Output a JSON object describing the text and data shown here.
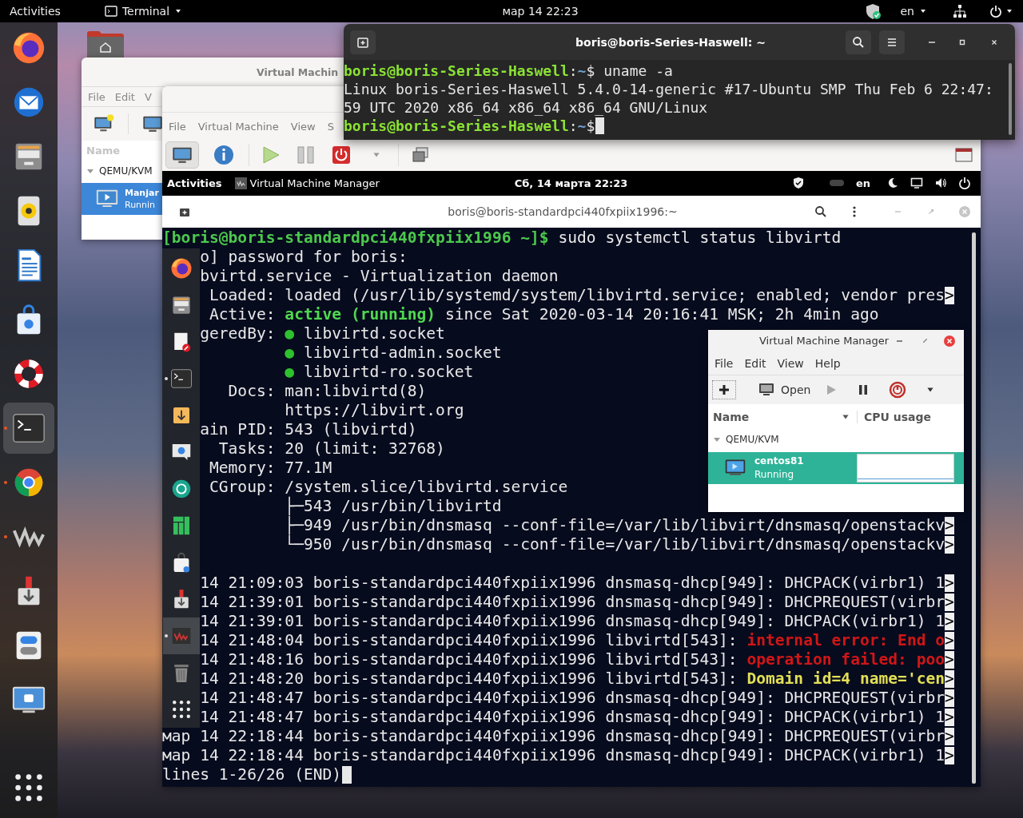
{
  "top_bar": {
    "activities": "Activities",
    "app_menu": "Terminal",
    "clock": "мар 14  22:23",
    "keyboard_layout": "en"
  },
  "dock": {
    "items": [
      {
        "running": false,
        "selected": false
      },
      {
        "running": false,
        "selected": false
      },
      {
        "running": false,
        "selected": false
      },
      {
        "running": false,
        "selected": false
      },
      {
        "running": false,
        "selected": false
      },
      {
        "running": false,
        "selected": false
      },
      {
        "running": false,
        "selected": false
      },
      {
        "running": true,
        "selected": true
      },
      {
        "running": true,
        "selected": false
      },
      {
        "running": true,
        "selected": false
      },
      {
        "running": false,
        "selected": false
      },
      {
        "running": false,
        "selected": false
      },
      {
        "running": false,
        "selected": false
      },
      {
        "running": false,
        "selected": false
      }
    ]
  },
  "vmm_back_window": {
    "title": "Virtual Machin",
    "menu": [
      "File",
      "Edit",
      "V"
    ],
    "list_header": "Name",
    "group": "QEMU/KVM",
    "vms": [
      {
        "name": "Manjar",
        "status": "Runnin",
        "selected": true
      }
    ]
  },
  "vmm_window": {
    "menu": [
      "File",
      "Virtual Machine",
      "View",
      "S"
    ],
    "view_tabs": [
      {
        "selected": true
      },
      {
        "selected": false
      }
    ]
  },
  "terminal_window": {
    "title": "boris@boris-Series-Haswell: ~",
    "lines": [
      {
        "kind": "full",
        "segments": [
          {
            "text": "boris@boris-Series-Haswell",
            "kind": "prompt"
          },
          {
            "text": ":",
            "kind": "plain"
          },
          {
            "text": "~",
            "kind": "path"
          },
          {
            "text": "$ uname -a",
            "kind": "plain"
          }
        ]
      },
      {
        "kind": "full",
        "segments": [
          {
            "text": "Linux boris-Series-Haswell 5.4.0-14-generic #17-Ubuntu SMP Thu Feb 6 22:47:",
            "kind": "plain"
          }
        ]
      },
      {
        "kind": "full",
        "segments": [
          {
            "text": "59 UTC 2020 x86_64 x86_64 x86_64 GNU/Linux",
            "kind": "plain"
          }
        ]
      },
      {
        "kind": "full",
        "segments": [
          {
            "text": "boris@boris-Series-Haswell",
            "kind": "prompt"
          },
          {
            "text": ":",
            "kind": "plain"
          },
          {
            "text": "~",
            "kind": "path"
          },
          {
            "text": "$",
            "kind": "plain"
          }
        ],
        "cursor": true
      }
    ]
  },
  "guest": {
    "top_bar": {
      "activities": "Activities",
      "app": "Virtual Machine Manager",
      "clock": "Сб, 14 марта  22:23",
      "keyboard_layout": "en"
    },
    "terminal": {
      "title": "boris@boris-standardpci440fxpiix1996:~",
      "lines": [
        {
          "kind": "full",
          "segments": [
            {
              "text": "[boris@boris-standardpci440fxpiix1996 ~]$",
              "kind": "prompt"
            },
            {
              "text": " sudo systemctl status libvirtd",
              "kind": "plain"
            }
          ]
        },
        {
          "kind": "under_dock",
          "segments": [
            {
              "text": "o] password for boris:",
              "kind": "plain"
            }
          ]
        },
        {
          "kind": "under_dock",
          "segments": [
            {
              "text": "bvirtd.service - Virtualization daemon",
              "kind": "plain"
            }
          ]
        },
        {
          "kind": "under_dock",
          "segments": [
            {
              "text": " Loaded: loaded (/usr/lib/systemd/system/libvirtd.service; enabled; vendor pres",
              "kind": "plain"
            }
          ],
          "more": ">"
        },
        {
          "kind": "under_dock",
          "segments": [
            {
              "text": " Active: ",
              "kind": "plain"
            },
            {
              "text": "active (running)",
              "kind": "ok"
            },
            {
              "text": " since Sat 2020-03-14 20:16:41 MSK; 2h 4min ago",
              "kind": "plain"
            }
          ]
        },
        {
          "kind": "under_dock",
          "segments": [
            {
              "text": "geredBy: ",
              "kind": "plain"
            },
            {
              "text": "●",
              "kind": "bullet"
            },
            {
              "text": " libvirtd.socket",
              "kind": "plain"
            }
          ]
        },
        {
          "kind": "under_dock",
          "segments": [
            {
              "text": "         ●",
              "kind": "bullet"
            },
            {
              "text": " libvirtd-admin.socket",
              "kind": "plain"
            }
          ]
        },
        {
          "kind": "under_dock",
          "segments": [
            {
              "text": "         ●",
              "kind": "bullet"
            },
            {
              "text": " libvirtd-ro.socket",
              "kind": "plain"
            }
          ]
        },
        {
          "kind": "under_dock",
          "segments": [
            {
              "text": "   Docs: man:libvirtd(8)",
              "kind": "plain"
            }
          ]
        },
        {
          "kind": "under_dock",
          "segments": [
            {
              "text": "         https://libvirt.org",
              "kind": "plain"
            }
          ]
        },
        {
          "kind": "under_dock",
          "segments": [
            {
              "text": "ain PID: 543 (libvirtd)",
              "kind": "plain"
            }
          ]
        },
        {
          "kind": "under_dock",
          "segments": [
            {
              "text": "  Tasks: 20 (limit: 32768)",
              "kind": "plain"
            }
          ]
        },
        {
          "kind": "under_dock",
          "segments": [
            {
              "text": " Memory: 77.1M",
              "kind": "plain"
            }
          ]
        },
        {
          "kind": "under_dock",
          "segments": [
            {
              "text": " CGroup: /system.slice/libvirtd.service",
              "kind": "plain"
            }
          ]
        },
        {
          "kind": "under_dock",
          "segments": [
            {
              "text": "         ├─543 /usr/bin/libvirtd",
              "kind": "plain"
            }
          ]
        },
        {
          "kind": "under_dock",
          "segments": [
            {
              "text": "         ├─949 /usr/bin/dnsmasq --conf-file=/var/lib/libvirt/dnsmasq/openstackv",
              "kind": "plain"
            }
          ],
          "more": ">"
        },
        {
          "kind": "under_dock",
          "segments": [
            {
              "text": "         └─950 /usr/bin/dnsmasq --conf-file=/var/lib/libvirt/dnsmasq/openstackv",
              "kind": "plain"
            }
          ],
          "more": ">"
        },
        {
          "kind": "blank"
        },
        {
          "kind": "under_dock",
          "segments": [
            {
              "text": "14 21:09:03 boris-standardpci440fxpiix1996 dnsmasq-dhcp[949]: DHCPACK(virbr1) 1",
              "kind": "plain"
            }
          ],
          "more": ">"
        },
        {
          "kind": "under_dock",
          "segments": [
            {
              "text": "14 21:39:01 boris-standardpci440fxpiix1996 dnsmasq-dhcp[949]: DHCPREQUEST(virbr",
              "kind": "plain"
            }
          ],
          "more": ">"
        },
        {
          "kind": "under_dock",
          "segments": [
            {
              "text": "14 21:39:01 boris-standardpci440fxpiix1996 dnsmasq-dhcp[949]: DHCPACK(virbr1) 1",
              "kind": "plain"
            }
          ],
          "more": ">"
        },
        {
          "kind": "under_dock",
          "segments": [
            {
              "text": "14 21:48:04 boris-standardpci440fxpiix1996 libvirtd[543]: ",
              "kind": "plain"
            },
            {
              "text": "internal error: End o",
              "kind": "error"
            }
          ],
          "more": ">"
        },
        {
          "kind": "under_dock",
          "segments": [
            {
              "text": "14 21:48:16 boris-standardpci440fxpiix1996 libvirtd[543]: ",
              "kind": "plain"
            },
            {
              "text": "operation failed: poo",
              "kind": "error"
            }
          ],
          "more": ">"
        },
        {
          "kind": "under_dock",
          "segments": [
            {
              "text": "14 21:48:20 boris-standardpci440fxpiix1996 libvirtd[543]: ",
              "kind": "plain"
            },
            {
              "text": "Domain id=4 name='cen",
              "kind": "warning"
            }
          ],
          "more": ">"
        },
        {
          "kind": "under_dock",
          "segments": [
            {
              "text": "14 21:48:47 boris-standardpci440fxpiix1996 dnsmasq-dhcp[949]: DHCPREQUEST(virbr",
              "kind": "plain"
            }
          ],
          "more": ">"
        },
        {
          "kind": "under_dock",
          "segments": [
            {
              "text": "14 21:48:47 boris-standardpci440fxpiix1996 dnsmasq-dhcp[949]: DHCPACK(virbr1) 1",
              "kind": "plain"
            }
          ],
          "more": ">"
        },
        {
          "kind": "full",
          "segments": [
            {
              "text": "мар 14 22:18:44 boris-standardpci440fxpiix1996 dnsmasq-dhcp[949]: DHCPREQUEST(virbr",
              "kind": "plain"
            }
          ],
          "more": ">"
        },
        {
          "kind": "full",
          "segments": [
            {
              "text": "мар 14 22:18:44 boris-standardpci440fxpiix1996 dnsmasq-dhcp[949]: DHCPACK(virbr1) 1",
              "kind": "plain"
            }
          ],
          "more": ">"
        },
        {
          "kind": "full",
          "segments": [
            {
              "text": "lines 1-26/26 (END)",
              "kind": "plain"
            }
          ],
          "cursor": true
        }
      ]
    },
    "dock": {
      "items": [
        {
          "running": false,
          "selected": false
        },
        {
          "running": false,
          "selected": false
        },
        {
          "running": false,
          "selected": false
        },
        {
          "running": true,
          "selected": false
        },
        {
          "running": false,
          "selected": false
        },
        {
          "running": false,
          "selected": false
        },
        {
          "running": false,
          "selected": false
        },
        {
          "running": false,
          "selected": false
        },
        {
          "running": false,
          "selected": false
        },
        {
          "running": false,
          "selected": false
        },
        {
          "running": true,
          "selected": true
        },
        {
          "running": false,
          "selected": false
        },
        {
          "running": false,
          "selected": false
        }
      ]
    },
    "vmm_window": {
      "title": "Virtual Machine Manager",
      "menu": [
        "File",
        "Edit",
        "View",
        "Help"
      ],
      "open_button": "Open",
      "columns": [
        "Name",
        "CPU usage"
      ],
      "group": "QEMU/KVM",
      "vms": [
        {
          "name": "centos81",
          "status": "Running",
          "selected": true
        }
      ]
    }
  }
}
